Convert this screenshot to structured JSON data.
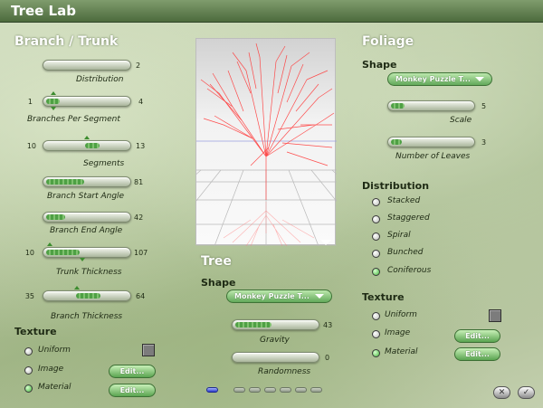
{
  "window": {
    "title": "Tree Lab"
  },
  "branch": {
    "heading": "Branch / Trunk",
    "distribution": {
      "label": "Distribution",
      "value": "2"
    },
    "branches_per_segment": {
      "label": "Branches Per Segment",
      "min": "1",
      "max": "4"
    },
    "segments": {
      "label": "Segments",
      "min": "10",
      "max": "13"
    },
    "branch_start_angle": {
      "label": "Branch Start Angle",
      "value": "81"
    },
    "branch_end_angle": {
      "label": "Branch End Angle",
      "value": "42"
    },
    "trunk_thickness": {
      "label": "Trunk Thickness",
      "min": "10",
      "max": "107"
    },
    "branch_thickness": {
      "label": "Branch Thickness",
      "min": "35",
      "max": "64"
    },
    "texture": {
      "heading": "Texture",
      "options": [
        "Uniform",
        "Image",
        "Material"
      ],
      "selected": "Material",
      "edit": "Edit..."
    }
  },
  "tree": {
    "heading": "Tree",
    "shape_label": "Shape",
    "shape_value": "Monkey Puzzle T...",
    "gravity": {
      "label": "Gravity",
      "value": "43"
    },
    "randomness": {
      "label": "Randomness",
      "value": "0"
    }
  },
  "foliage": {
    "heading": "Foliage",
    "shape_label": "Shape",
    "shape_value": "Monkey Puzzle T...",
    "scale": {
      "label": "Scale",
      "value": "5"
    },
    "number_of_leaves": {
      "label": "Number of Leaves",
      "value": "3"
    },
    "distribution": {
      "heading": "Distribution",
      "options": [
        "Stacked",
        "Staggered",
        "Spiral",
        "Bunched",
        "Coniferous"
      ],
      "selected": "Coniferous"
    },
    "texture": {
      "heading": "Texture",
      "options": [
        "Uniform",
        "Image",
        "Material"
      ],
      "selected": "Material",
      "edit": "Edit..."
    }
  },
  "footer": {
    "cancel_icon": "close-icon",
    "ok_icon": "check-icon",
    "pages": 7,
    "current_page": 1
  },
  "colors": {
    "accent": "#4ea044",
    "tree": "#ff3b3b"
  }
}
